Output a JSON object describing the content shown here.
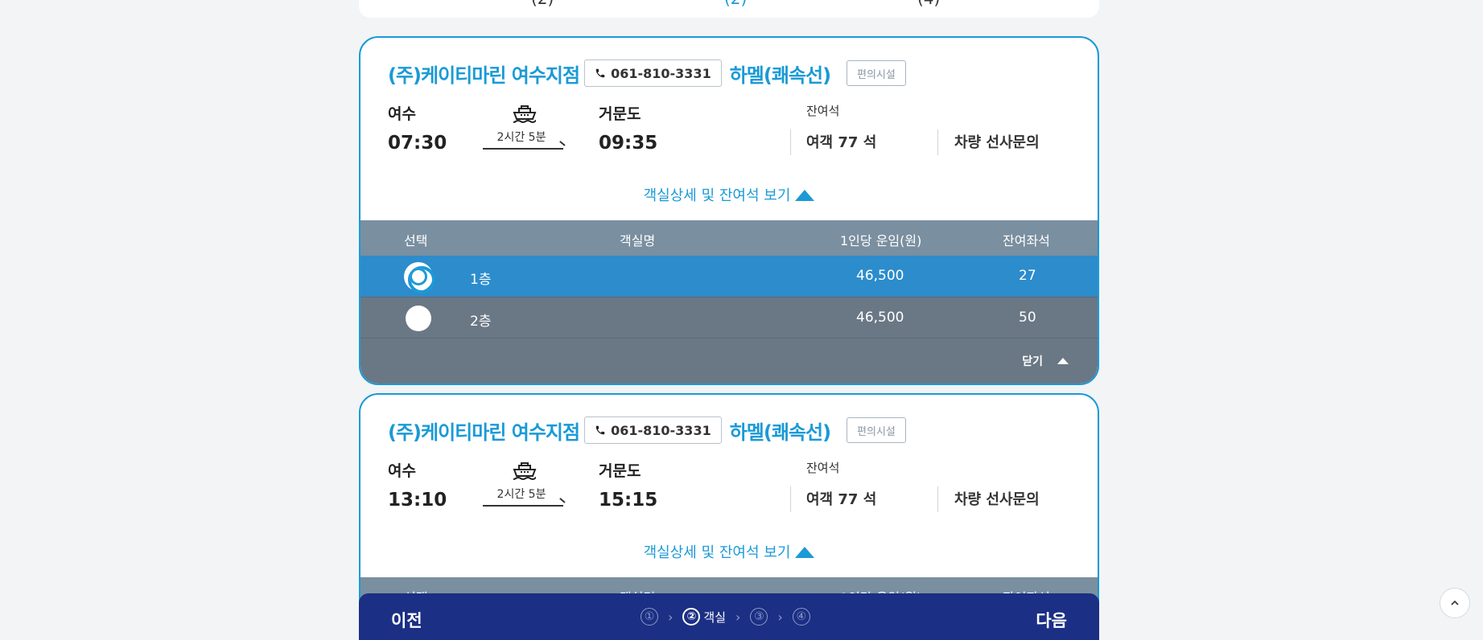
{
  "top_peek": {
    "items": [
      "(2)",
      "(2)",
      "(4)"
    ]
  },
  "cards": [
    {
      "company": "(주)케이티마린 여수지점",
      "phone": "061-810-3331",
      "ship": "하멜(쾌속선)",
      "facility_label": "편의시설",
      "departure_port": "여수",
      "departure_time": "07:30",
      "duration": "2시간 5분",
      "arrival_port": "거문도",
      "arrival_time": "09:35",
      "seat_label": "잔여석",
      "passenger_seats": "여객 77 석",
      "vehicle_info": "차량 선사문의",
      "toggle_label": "객실상세 및 잔여석 보기"
    },
    {
      "company": "(주)케이티마린 여수지점",
      "phone": "061-810-3331",
      "ship": "하멜(쾌속선)",
      "facility_label": "편의시설",
      "departure_port": "여수",
      "departure_time": "13:10",
      "duration": "2시간 5분",
      "arrival_port": "거문도",
      "arrival_time": "15:15",
      "seat_label": "잔여석",
      "passenger_seats": "여객 77 석",
      "vehicle_info": "차량 선사문의",
      "toggle_label": "객실상세 및 잔여석 보기"
    }
  ],
  "room_table": {
    "headers": [
      "선택",
      "객실명",
      "1인당 운임(원)",
      "잔여좌석"
    ],
    "rows": [
      {
        "name": "1층",
        "fare": "46,500",
        "remaining": "27",
        "selected": true
      },
      {
        "name": "2층",
        "fare": "46,500",
        "remaining": "50",
        "selected": false
      }
    ],
    "close_label": "닫기"
  },
  "bottom_bar": {
    "prev_label": "이전",
    "next_label": "다음",
    "steps": [
      "①",
      "②",
      "③",
      "④"
    ],
    "active_step_label": "객실"
  },
  "colors": {
    "accent": "#1a9ad6",
    "bottom_bar": "#1b2f84",
    "table_header": "#7a8fa0",
    "row_selected": "#2c8ccc",
    "row_normal": "#6a7785"
  },
  "icons": {
    "phone": "phone-icon",
    "ferry": "ferry-icon",
    "scroll_top": "chevron-up-icon"
  }
}
